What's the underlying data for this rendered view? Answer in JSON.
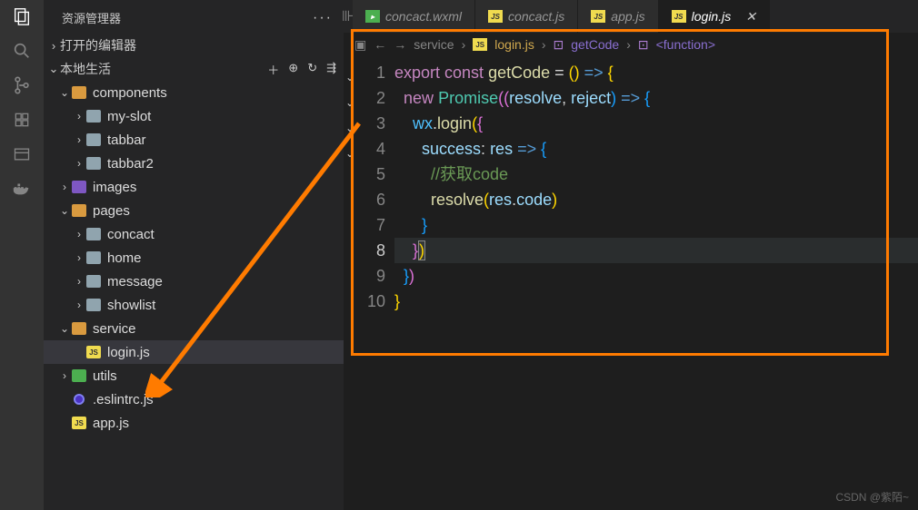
{
  "explorer": {
    "title": "资源管理器"
  },
  "sections": {
    "openEditors": "打开的编辑器",
    "workspace": "本地生活"
  },
  "tree": {
    "components": "components",
    "mySlot": "my-slot",
    "tabbar": "tabbar",
    "tabbar2": "tabbar2",
    "images": "images",
    "pages": "pages",
    "concact": "concact",
    "home": "home",
    "message": "message",
    "showlist": "showlist",
    "service": "service",
    "loginjs": "login.js",
    "utils": "utils",
    "eslintrc": ".eslintrc.js",
    "appjs": "app.js"
  },
  "tabs": {
    "t1": "concact.wxml",
    "t2": "concact.js",
    "t3": "app.js",
    "t4": "login.js"
  },
  "breadcrumb": {
    "p1": "service",
    "p2": "login.js",
    "p3": "getCode",
    "p4": "<function>"
  },
  "code": {
    "l1_export": "export",
    "l1_const": " const ",
    "l1_fn": "getCode",
    "l1_rest": " = ",
    "l1_par": "()",
    "l1_arrow": " => ",
    "l1_brace": "{",
    "l2_indent": "  ",
    "l2_new": "new",
    "l2_sp": " ",
    "l2_promise": "Promise",
    "l2_p1": "((",
    "l2_resolve": "resolve",
    "l2_comma": ", ",
    "l2_reject": "reject",
    "l2_p2": ")",
    "l2_arrow": " => ",
    "l2_brace": "{",
    "l3_indent": "    ",
    "l3_wx": "wx",
    "l3_dot": ".",
    "l3_login": "login",
    "l3_p": "(",
    "l3_brace": "{",
    "l4_indent": "      ",
    "l4_success": "success",
    "l4_colon": ": ",
    "l4_res": "res",
    "l4_arrow": " => ",
    "l4_brace": "{",
    "l5_indent": "        ",
    "l5_comment": "//获取code",
    "l6_indent": "        ",
    "l6_resolve": "resolve",
    "l6_p1": "(",
    "l6_res": "res",
    "l6_dot": ".",
    "l6_code": "code",
    "l6_p2": ")",
    "l7_indent": "      ",
    "l7_brace": "}",
    "l8_indent": "    ",
    "l8_brace": "}",
    "l8_paren": ")",
    "l9_indent": "  ",
    "l9_brace": "}",
    "l9_paren": ")",
    "l10_brace": "}"
  },
  "watermark": "CSDN @紫陌~"
}
